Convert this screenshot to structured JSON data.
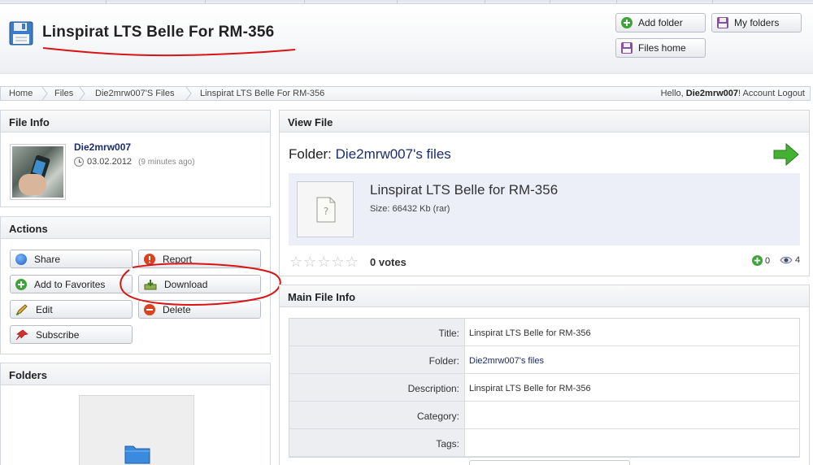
{
  "header": {
    "title": "Linspirat LTS Belle For RM-356",
    "buttons": {
      "add_folder": "Add folder",
      "my_folders": "My folders",
      "files_home": "Files home"
    }
  },
  "breadcrumb": {
    "items": [
      "Home",
      "Files",
      "Die2mrw007'S Files",
      "Linspirat LTS Belle For RM-356"
    ],
    "hello_prefix": "Hello,",
    "username": "Die2mrw007",
    "hello_suffix": "!",
    "account": "Account",
    "logout": "Logout"
  },
  "file_info": {
    "heading": "File Info",
    "user": "Die2mrw007",
    "date": "03.02.2012",
    "ago": "(9 minutes ago)"
  },
  "actions": {
    "heading": "Actions",
    "share": "Share",
    "report": "Report",
    "add_favorites": "Add to Favorites",
    "download": "Download",
    "edit": "Edit",
    "delete": "Delete",
    "subscribe": "Subscribe"
  },
  "folders": {
    "heading": "Folders"
  },
  "view_file": {
    "heading": "View File",
    "folder_prefix": "Folder:",
    "folder_name": "Die2mrw007's files",
    "file_name": "Linspirat LTS Belle for RM-356",
    "size": "Size: 66432 Kb (rar)",
    "votes": "0 votes",
    "rating_stars": 0,
    "plus_count": "0",
    "views_count": "4"
  },
  "main_info": {
    "heading": "Main File Info",
    "rows": [
      {
        "label": "Title:",
        "value": "Linspirat LTS Belle for RM-356"
      },
      {
        "label": "Folder:",
        "value": "Die2mrw007's files"
      },
      {
        "label": "Description:",
        "value": "Linspirat LTS Belle for RM-356"
      },
      {
        "label": "Category:",
        "value": ""
      },
      {
        "label": "Tags:",
        "value": ""
      }
    ]
  },
  "colors": {
    "link": "#1a2d6e",
    "panel_bg": "#eceef8",
    "annotation_red": "#d81414",
    "arrow_green": "#44b133"
  },
  "icons": {
    "title": "floppy-disk-icon",
    "add_folder": "plus-circle-icon",
    "my_folders": "disk-icon",
    "share": "blue-circle-icon",
    "report": "warning-circle-icon",
    "favorites": "plus-circle-icon",
    "download": "download-tray-icon",
    "edit": "pencil-icon",
    "delete": "minus-circle-icon",
    "subscribe": "pin-icon",
    "next": "green-arrow-right-icon"
  }
}
